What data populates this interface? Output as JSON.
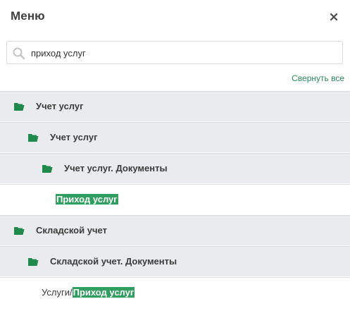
{
  "header": {
    "title": "Меню",
    "close_icon": "close-icon"
  },
  "search": {
    "value": "приход услуг",
    "placeholder": "",
    "icon": "search-icon"
  },
  "collapse_all_label": "Свернуть все",
  "colors": {
    "accent_green": "#2f9e5e",
    "folder_green": "#1f8a4c",
    "link_green": "#2a8a5a",
    "folder_row_bg": "#e9ebee"
  },
  "tree": [
    {
      "type": "folder",
      "level": 0,
      "label": "Учет услуг",
      "icon": "folder-open-icon"
    },
    {
      "type": "folder",
      "level": 1,
      "label": "Учет услуг",
      "icon": "folder-open-icon"
    },
    {
      "type": "folder",
      "level": 2,
      "label": "Учет услуг. Документы",
      "icon": "folder-open-icon"
    },
    {
      "type": "leaf",
      "level": 3,
      "prefix": "",
      "highlight": "Приход услуг"
    },
    {
      "type": "folder",
      "level": 0,
      "label": "Складской учет",
      "icon": "folder-open-icon"
    },
    {
      "type": "folder",
      "level": 1,
      "label": "Складской учет. Документы",
      "icon": "folder-open-icon"
    },
    {
      "type": "leaf",
      "level": 2,
      "prefix": "Услуги/",
      "highlight": "Приход услуг"
    }
  ]
}
